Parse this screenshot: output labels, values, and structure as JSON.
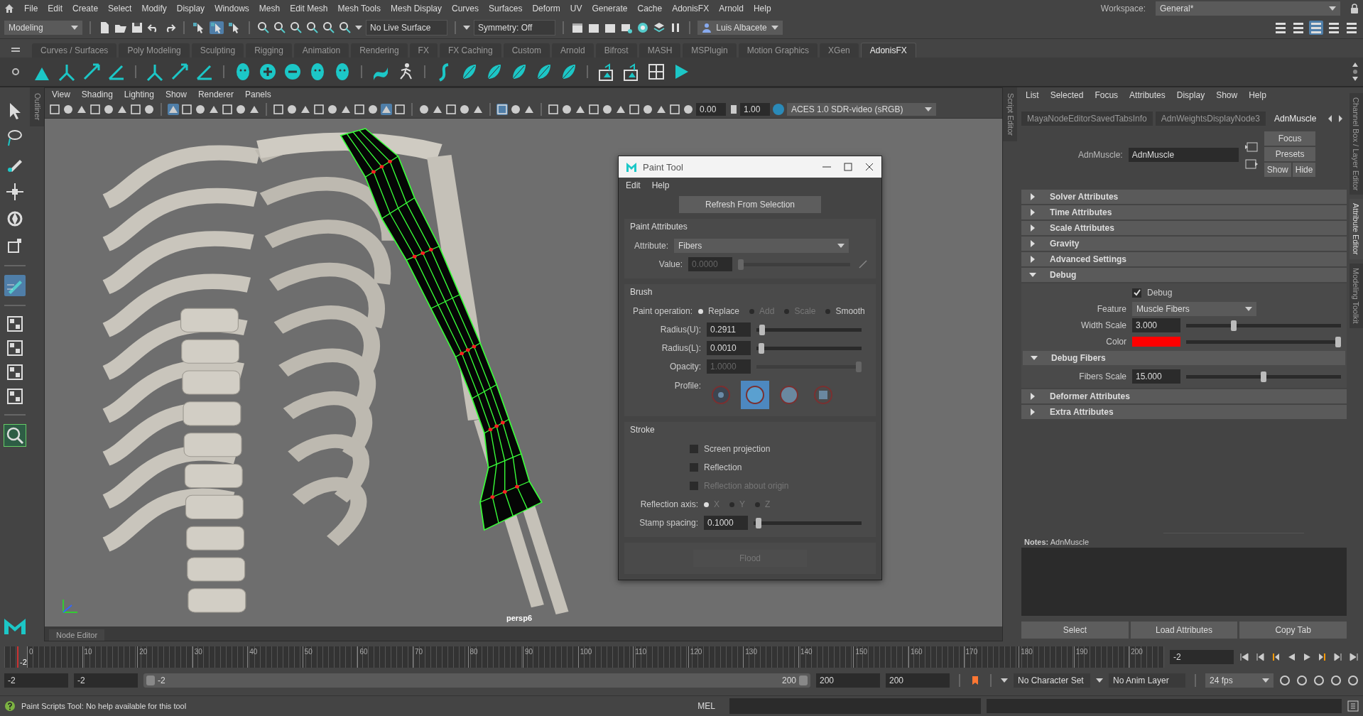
{
  "menu_bar": {
    "items": [
      "File",
      "Edit",
      "Create",
      "Select",
      "Modify",
      "Display",
      "Windows",
      "Mesh",
      "Edit Mesh",
      "Mesh Tools",
      "Mesh Display",
      "Curves",
      "Surfaces",
      "Deform",
      "UV",
      "Generate",
      "Cache",
      "AdonisFX",
      "Arnold",
      "Help"
    ],
    "workspace_label": "Workspace:",
    "workspace": "General*"
  },
  "status_line": {
    "mode": "Modeling",
    "live_surface": "No Live Surface",
    "symmetry": "Symmetry: Off",
    "user": "Luis Albacete"
  },
  "shelf": {
    "tabs": [
      {
        "label": "Curves / Surfaces",
        "selected": false
      },
      {
        "label": "Poly Modeling",
        "selected": false
      },
      {
        "label": "Sculpting",
        "selected": false
      },
      {
        "label": "Rigging",
        "selected": false
      },
      {
        "label": "Animation",
        "selected": false
      },
      {
        "label": "Rendering",
        "selected": false
      },
      {
        "label": "FX",
        "selected": false
      },
      {
        "label": "FX Caching",
        "selected": false
      },
      {
        "label": "Custom",
        "selected": false
      },
      {
        "label": "Arnold",
        "selected": false
      },
      {
        "label": "Bifrost",
        "selected": false
      },
      {
        "label": "MASH",
        "selected": false
      },
      {
        "label": "MSPlugin",
        "selected": false
      },
      {
        "label": "Motion Graphics",
        "selected": false
      },
      {
        "label": "XGen",
        "selected": false
      },
      {
        "label": "AdonisFX",
        "selected": true
      }
    ]
  },
  "side_tabs": {
    "outliner": "Outliner",
    "script_editor": "Script Editor",
    "right": [
      {
        "label": "Channel Box / Layer Editor",
        "selected": false
      },
      {
        "label": "Attribute Editor",
        "selected": true
      },
      {
        "label": "Modeling Toolkit",
        "selected": false
      }
    ]
  },
  "viewport": {
    "menu": [
      "View",
      "Shading",
      "Lighting",
      "Show",
      "Renderer",
      "Panels"
    ],
    "exposure": "0.00",
    "gamma": "1.00",
    "color_space": "ACES 1.0 SDR-video (sRGB)",
    "camera": "persp6"
  },
  "paint_tool": {
    "title": "Paint Tool",
    "menu": [
      "Edit",
      "Help"
    ],
    "refresh_button": "Refresh From Selection",
    "paint_attributes": {
      "heading": "Paint Attributes",
      "attribute_label": "Attribute:",
      "attribute": "Fibers",
      "value_label": "Value:",
      "value": "0.0000",
      "level": 0.0,
      "disabled": true
    },
    "brush": {
      "heading": "Brush",
      "operation_label": "Paint operation:",
      "operations": [
        {
          "label": "Replace",
          "selected": true,
          "disabled": false
        },
        {
          "label": "Add",
          "selected": false,
          "disabled": true
        },
        {
          "label": "Scale",
          "selected": false,
          "disabled": true
        },
        {
          "label": "Smooth",
          "selected": false,
          "disabled": false
        }
      ],
      "sliders": [
        {
          "label": "Radius(U):",
          "value": "0.2911",
          "level": 0.03,
          "disabled": false
        },
        {
          "label": "Radius(L):",
          "value": "0.0010",
          "level": 0.02,
          "disabled": false
        },
        {
          "label": "Opacity:",
          "value": "1.0000",
          "level": 1.0,
          "disabled": true
        }
      ],
      "profile_label": "Profile:",
      "profiles": [
        {
          "kind": "gaussian",
          "selected": false
        },
        {
          "kind": "soft",
          "selected": true
        },
        {
          "kind": "solid",
          "selected": false
        },
        {
          "kind": "square",
          "selected": false
        }
      ]
    },
    "stroke": {
      "heading": "Stroke",
      "checkboxes": [
        {
          "label": "Screen projection",
          "checked": false,
          "disabled": false
        },
        {
          "label": "Reflection",
          "checked": false,
          "disabled": false
        },
        {
          "label": "Reflection about origin",
          "checked": false,
          "disabled": true
        }
      ],
      "axis_label": "Reflection axis:",
      "axes": [
        {
          "label": "X",
          "selected": true,
          "disabled": true
        },
        {
          "label": "Y",
          "selected": false,
          "disabled": true
        },
        {
          "label": "Z",
          "selected": false,
          "disabled": true
        }
      ],
      "stamp": {
        "label": "Stamp spacing:",
        "value": "0.1000",
        "level": 0.02
      }
    },
    "flood": {
      "label": "Flood",
      "disabled": true
    }
  },
  "attribute_editor": {
    "menu": [
      "List",
      "Selected",
      "Focus",
      "Attributes",
      "Display",
      "Show",
      "Help"
    ],
    "tabs": [
      {
        "label": "MayaNodeEditorSavedTabsInfo",
        "selected": false
      },
      {
        "label": "AdnWeightsDisplayNode3",
        "selected": false
      },
      {
        "label": "AdnMuscle",
        "selected": true
      }
    ],
    "node_label": "AdnMuscle:",
    "node_name": "AdnMuscle",
    "buttons": [
      "Focus",
      "Presets",
      "Show",
      "Hide"
    ],
    "sections": [
      {
        "title": "Solver Attributes",
        "expanded": false
      },
      {
        "title": "Time Attributes",
        "expanded": false
      },
      {
        "title": "Scale Attributes",
        "expanded": false
      },
      {
        "title": "Gravity",
        "expanded": false
      },
      {
        "title": "Advanced Settings",
        "expanded": false
      },
      {
        "title": "Debug",
        "expanded": true,
        "fields": [
          {
            "kind": "checkbox",
            "label": "Debug",
            "checked": true
          },
          {
            "kind": "dropdown",
            "label": "Feature",
            "value": "Muscle Fibers"
          },
          {
            "kind": "slider",
            "label": "Width Scale",
            "value": "3.000",
            "level": 0.3
          },
          {
            "kind": "color",
            "label": "Color",
            "color": "#ff0000",
            "level": 1.0
          }
        ],
        "subsections": [
          {
            "title": "Debug Fibers",
            "expanded": true,
            "fields": [
              {
                "kind": "slider",
                "label": "Fibers Scale",
                "value": "15.000",
                "level": 0.5
              }
            ]
          }
        ]
      },
      {
        "title": "Deformer Attributes",
        "expanded": false
      },
      {
        "title": "Extra Attributes",
        "expanded": false
      }
    ],
    "notes": "**Notes:**  AdnMuscle",
    "bottom_buttons": [
      "Select",
      "Load Attributes",
      "Copy Tab"
    ]
  },
  "node_editor_tab": "Node Editor",
  "timeline": {
    "ticks": [
      "0",
      "10",
      "20",
      "30",
      "40",
      "50",
      "60",
      "70",
      "80",
      "90",
      "100",
      "110",
      "120",
      "130",
      "140",
      "150",
      "160",
      "170",
      "180",
      "190",
      "200"
    ],
    "current_frame": "-2",
    "level": 0.0,
    "current_field": "-2"
  },
  "range": {
    "start": "-2",
    "playback_start": "-2",
    "slider_start": "-2",
    "slider_end": "200",
    "level": 1.0,
    "playback_end": "200",
    "end": "200",
    "character_set": "No Character Set",
    "anim_layer": "No Anim Layer",
    "fps": "24 fps"
  },
  "help_line": {
    "text": "Paint Scripts Tool: No help available for this tool",
    "language": "MEL"
  }
}
